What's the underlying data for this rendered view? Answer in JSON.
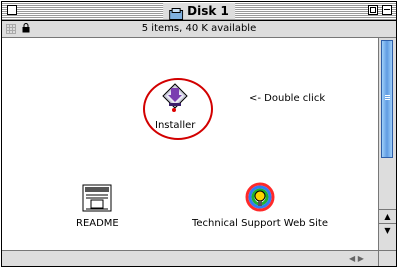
{
  "window": {
    "title": "Disk 1",
    "info": "5 items, 40 K available"
  },
  "items": {
    "installer": "Installer",
    "readme": "README",
    "support": "Technical Support Web Site"
  },
  "note": "<- Double click",
  "colors": {
    "highlight_circle": "#d20000",
    "scroll_thumb": "#5f9be2"
  },
  "icons": {
    "installer": "installer-icon",
    "readme": "readme-icon",
    "support": "web-support-icon",
    "disk": "disk-icon",
    "lock": "lock-icon"
  }
}
